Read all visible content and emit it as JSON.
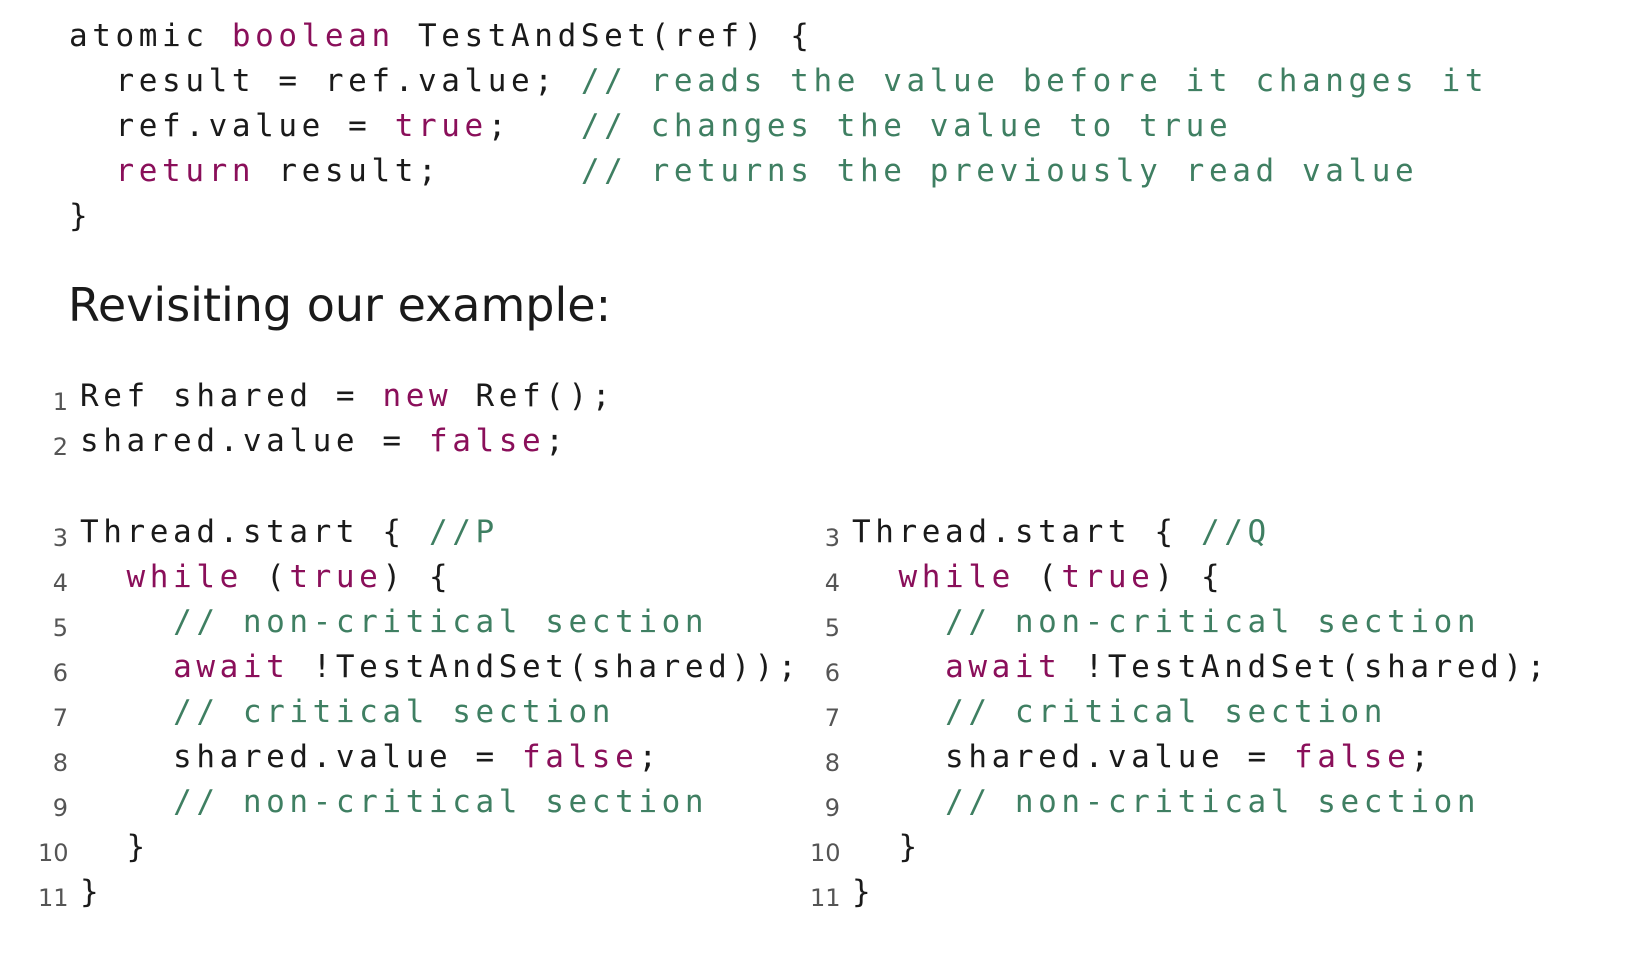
{
  "definition": {
    "lines": [
      [
        {
          "t": "atomic ",
          "c": "pl"
        },
        {
          "t": "boolean",
          "c": "kw"
        },
        {
          "t": " TestAndSet(ref) {",
          "c": "pl"
        }
      ],
      [
        {
          "t": "  result = ref.value; ",
          "c": "pl"
        },
        {
          "t": "// reads the value before it changes it",
          "c": "cm"
        }
      ],
      [
        {
          "t": "  ref.value = ",
          "c": "pl"
        },
        {
          "t": "true",
          "c": "kw"
        },
        {
          "t": ";   ",
          "c": "pl"
        },
        {
          "t": "// changes the value to true",
          "c": "cm"
        }
      ],
      [
        {
          "t": "  ",
          "c": "pl"
        },
        {
          "t": "return",
          "c": "kw"
        },
        {
          "t": " result;      ",
          "c": "pl"
        },
        {
          "t": "// returns the previously read value",
          "c": "cm"
        }
      ],
      [
        {
          "t": "}",
          "c": "pl"
        }
      ]
    ]
  },
  "heading": "Revisiting our example:",
  "init": {
    "lines": [
      {
        "n": "1",
        "parts": [
          {
            "t": "Ref shared = ",
            "c": "pl"
          },
          {
            "t": "new",
            "c": "kw"
          },
          {
            "t": " Ref();",
            "c": "pl"
          }
        ]
      },
      {
        "n": "2",
        "parts": [
          {
            "t": "shared.value = ",
            "c": "pl"
          },
          {
            "t": "false",
            "c": "kw"
          },
          {
            "t": ";",
            "c": "pl"
          }
        ]
      }
    ]
  },
  "thread_p": {
    "lines": [
      {
        "n": "3",
        "parts": [
          {
            "t": "Thread.start { ",
            "c": "pl"
          },
          {
            "t": "//P",
            "c": "cm"
          }
        ]
      },
      {
        "n": "4",
        "parts": [
          {
            "t": "  ",
            "c": "pl"
          },
          {
            "t": "while",
            "c": "kw"
          },
          {
            "t": " (",
            "c": "pl"
          },
          {
            "t": "true",
            "c": "kw"
          },
          {
            "t": ") {",
            "c": "pl"
          }
        ]
      },
      {
        "n": "5",
        "parts": [
          {
            "t": "    ",
            "c": "pl"
          },
          {
            "t": "// non-critical section",
            "c": "cm"
          }
        ]
      },
      {
        "n": "6",
        "parts": [
          {
            "t": "    ",
            "c": "pl"
          },
          {
            "t": "await",
            "c": "kw"
          },
          {
            "t": " !TestAndSet(shared));",
            "c": "pl"
          }
        ]
      },
      {
        "n": "7",
        "parts": [
          {
            "t": "    ",
            "c": "pl"
          },
          {
            "t": "// critical section",
            "c": "cm"
          }
        ]
      },
      {
        "n": "8",
        "parts": [
          {
            "t": "    shared.value = ",
            "c": "pl"
          },
          {
            "t": "false",
            "c": "kw"
          },
          {
            "t": ";",
            "c": "pl"
          }
        ]
      },
      {
        "n": "9",
        "parts": [
          {
            "t": "    ",
            "c": "pl"
          },
          {
            "t": "// non-critical section",
            "c": "cm"
          }
        ]
      },
      {
        "n": "10",
        "parts": [
          {
            "t": "  }",
            "c": "pl"
          }
        ]
      },
      {
        "n": "11",
        "parts": [
          {
            "t": "}",
            "c": "pl"
          }
        ]
      }
    ]
  },
  "thread_q": {
    "lines": [
      {
        "n": "3",
        "parts": [
          {
            "t": "Thread.start { ",
            "c": "pl"
          },
          {
            "t": "//Q",
            "c": "cm"
          }
        ]
      },
      {
        "n": "4",
        "parts": [
          {
            "t": "  ",
            "c": "pl"
          },
          {
            "t": "while",
            "c": "kw"
          },
          {
            "t": " (",
            "c": "pl"
          },
          {
            "t": "true",
            "c": "kw"
          },
          {
            "t": ") {",
            "c": "pl"
          }
        ]
      },
      {
        "n": "5",
        "parts": [
          {
            "t": "    ",
            "c": "pl"
          },
          {
            "t": "// non-critical section",
            "c": "cm"
          }
        ]
      },
      {
        "n": "6",
        "parts": [
          {
            "t": "    ",
            "c": "pl"
          },
          {
            "t": "await",
            "c": "kw"
          },
          {
            "t": " !TestAndSet(shared);",
            "c": "pl"
          }
        ]
      },
      {
        "n": "7",
        "parts": [
          {
            "t": "    ",
            "c": "pl"
          },
          {
            "t": "// critical section",
            "c": "cm"
          }
        ]
      },
      {
        "n": "8",
        "parts": [
          {
            "t": "    shared.value = ",
            "c": "pl"
          },
          {
            "t": "false",
            "c": "kw"
          },
          {
            "t": ";",
            "c": "pl"
          }
        ]
      },
      {
        "n": "9",
        "parts": [
          {
            "t": "    ",
            "c": "pl"
          },
          {
            "t": "// non-critical section",
            "c": "cm"
          }
        ]
      },
      {
        "n": "10",
        "parts": [
          {
            "t": "  }",
            "c": "pl"
          }
        ]
      },
      {
        "n": "11",
        "parts": [
          {
            "t": "}",
            "c": "pl"
          }
        ]
      }
    ]
  },
  "colors": {
    "keyword": "#8a0f5a",
    "comment": "#3f7f62",
    "text": "#1a1a1a",
    "line_number": "#555555"
  }
}
